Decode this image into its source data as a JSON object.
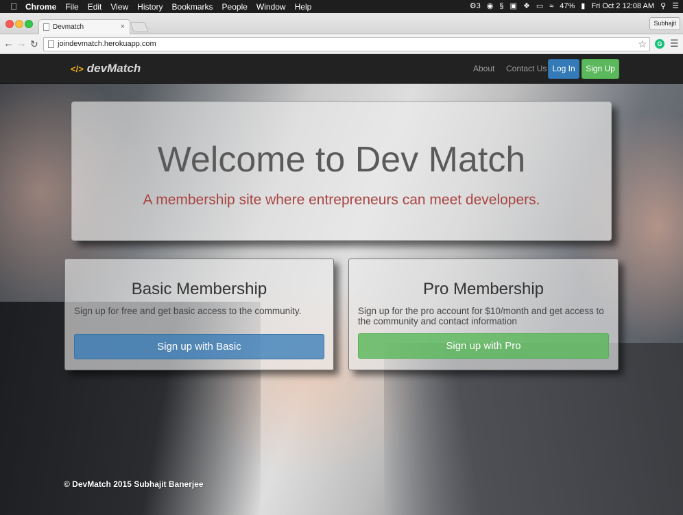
{
  "os_menubar": {
    "apple": "",
    "items": [
      "Chrome",
      "File",
      "Edit",
      "View",
      "History",
      "Bookmarks",
      "People",
      "Window",
      "Help"
    ],
    "status": {
      "notif_count": "3",
      "battery": "47%",
      "datetime": "Fri Oct 2  12:08 AM"
    }
  },
  "browser": {
    "tab_title": "Devmatch",
    "tab_close": "×",
    "profile": "Subhajit",
    "url": "joindevmatch.herokuapp.com",
    "ext_letter": "G"
  },
  "site": {
    "brand_icon": "</>",
    "brand": "devMatch",
    "nav": {
      "about": "About",
      "contact": "Contact Us",
      "login": "Log In",
      "signup": "Sign Up"
    },
    "jumbotron": {
      "title": "Welcome to Dev Match",
      "subtitle": "A membership site where entrepreneurs can meet developers."
    },
    "plans": {
      "basic": {
        "title": "Basic Membership",
        "description": "Sign up for free and get basic access to the community.",
        "button": "Sign up with Basic"
      },
      "pro": {
        "title": "Pro Membership",
        "description": "Sign up for the pro account for $10/month and get access to the community and contact information",
        "button": "Sign up with Pro"
      }
    },
    "footer": "© DevMatch 2015 Subhajit Banerjee"
  },
  "colors": {
    "primary": "#337ab7",
    "success": "#5cb85c",
    "subtitle": "#a94442",
    "navbar": "#222222"
  }
}
